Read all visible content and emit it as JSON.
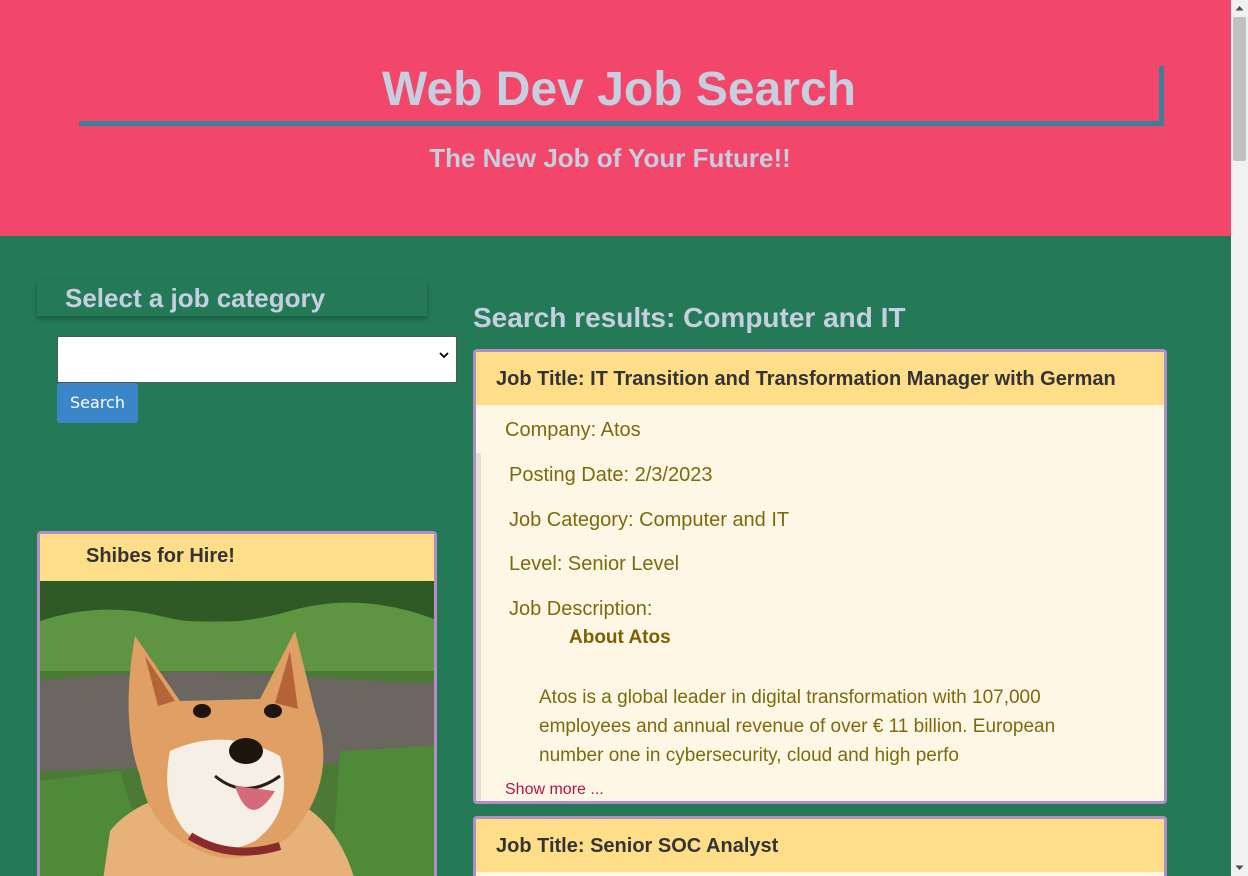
{
  "header": {
    "title": "Web Dev Job Search",
    "subtitle": "The New Job of Your Future!!"
  },
  "sidebar": {
    "category_heading": "Select a job category",
    "category_select_value": "",
    "search_label": "Search",
    "shibe_card_title": "Shibes for Hire!"
  },
  "results": {
    "heading": "Search results: Computer and IT",
    "jobs": [
      {
        "title": "Job Title: IT Transition and Transformation Manager with German",
        "company": "Company: Atos",
        "posting_date": "Posting Date: 2/3/2023",
        "category": "Job Category: Computer and IT",
        "level": "Level: Senior Level",
        "description_label": "Job Description:",
        "about_heading": "About Atos",
        "description": "Atos is a global leader in digital transformation with 107,000 employees and annual revenue of over € 11 billion. European number one in cybersecurity, cloud and high perfo",
        "show_more": "Show more ..."
      },
      {
        "title": "Job Title: Senior SOC Analyst"
      }
    ]
  },
  "colors": {
    "header_bg": "#f2476a",
    "page_bg": "#247a57",
    "card_header_bg": "#ffde89",
    "card_border": "#b48dc4",
    "heading_text": "#c6cfe0",
    "button_bg": "#3a86c9"
  }
}
